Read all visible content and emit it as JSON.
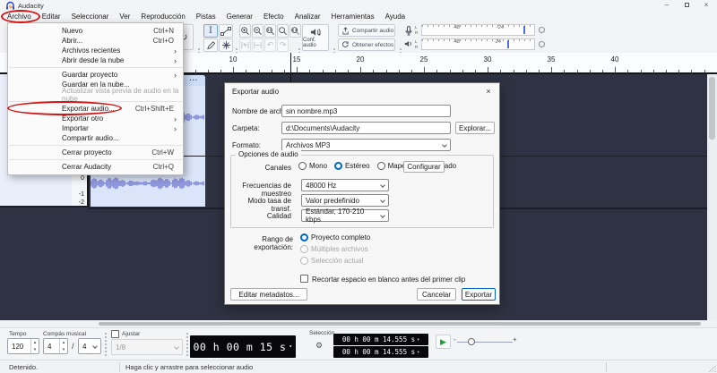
{
  "window": {
    "title": "Audacity"
  },
  "glyphs": {
    "minimize": "–",
    "close": "×",
    "submenu": "›",
    "dropdown": "▾",
    "undo": "↶",
    "redo": "↷",
    "loop": "↻",
    "gear": "⚙",
    "play": "▶",
    "minus": "-",
    "plus": "+",
    "ibeam": "I",
    "star": "✳",
    "ellipsis": "..."
  },
  "menubar": {
    "items": [
      "Archivo",
      "Editar",
      "Seleccionar",
      "Ver",
      "Reproducción",
      "Pistas",
      "Generar",
      "Efecto",
      "Analizar",
      "Herramientas",
      "Ayuda"
    ]
  },
  "file_menu": {
    "items": [
      {
        "label": "Nuevo",
        "shortcut": "Ctrl+N"
      },
      {
        "label": "Abrir...",
        "shortcut": "Ctrl+O"
      },
      {
        "label": "Archivos recientes",
        "submenu": true
      },
      {
        "label": "Abrir desde la nube",
        "submenu": true
      },
      {
        "separator": true
      },
      {
        "label": "Guardar proyecto",
        "submenu": true
      },
      {
        "label": "Guardar en la nube..."
      },
      {
        "label": "Actualizar vista previa de audio en la nube",
        "disabled": true
      },
      {
        "separator": true
      },
      {
        "label": "Exportar audio...",
        "shortcut": "Ctrl+Shift+E",
        "annotated": true
      },
      {
        "label": "Exportar otro",
        "submenu": true
      },
      {
        "label": "Importar",
        "submenu": true
      },
      {
        "label": "Compartir audio..."
      },
      {
        "separator": true
      },
      {
        "label": "Cerrar proyecto",
        "shortcut": "Ctrl+W"
      },
      {
        "separator": true
      },
      {
        "label": "Cerrar Audacity",
        "shortcut": "Ctrl+Q"
      }
    ]
  },
  "toolbar": {
    "conf_audio": "Conf. audio",
    "share_audio": "Compartir audio",
    "get_effects": "Obtener efectos",
    "meter_ticks": [
      "-48",
      "-24"
    ],
    "channel_labels": [
      "L",
      "R"
    ]
  },
  "ruler": {
    "labels": [
      "10",
      "15",
      "20",
      "25",
      "30",
      "35",
      "40"
    ]
  },
  "track": {
    "clip_title": "...",
    "scale_labels": [
      "0",
      "-1",
      "-2"
    ]
  },
  "dialog": {
    "title": "Exportar audio",
    "filename_label": "Nombre de archivo:",
    "filename_value": "sin nombre.mp3",
    "folder_label": "Carpeta:",
    "folder_value": "d:\\Documents\\Audacity",
    "browse_label": "Explorar...",
    "format_label": "Formato:",
    "format_value": "Archivos MP3",
    "audio_options_title": "Opciones de audio",
    "channels_label": "Canales",
    "channel_options": [
      {
        "label": "Mono",
        "selected": false
      },
      {
        "label": "Estéreo",
        "selected": true
      },
      {
        "label": "Mapeo personalizado",
        "selected": false
      }
    ],
    "configure_label": "Configurar",
    "sample_rate_label": "Frecuencias de muestreo",
    "sample_rate_value": "48000 Hz",
    "bitrate_mode_label": "Modo tasa de transf.",
    "bitrate_mode_value": "Valor predefinido",
    "quality_label": "Calidad",
    "quality_value": "Estándar, 170-210 kbps",
    "export_range_label": "Rango de exportación:",
    "export_range_options": [
      {
        "label": "Proyecto completo",
        "selected": true
      },
      {
        "label": "Múltiples archivos",
        "disabled": true
      },
      {
        "label": "Selección actual",
        "disabled": true
      }
    ],
    "trim_checkbox_label": "Recortar espacio en blanco antes del primer clip",
    "edit_metadata_label": "Editar metadatos...",
    "cancel_label": "Cancelar",
    "export_label": "Exportar"
  },
  "bottom": {
    "tempo_label": "Tempo",
    "tempo_value": "120",
    "time_sig_label": "Compás musical",
    "time_sig_upper": "4",
    "time_sig_slash": "/",
    "time_sig_lower": "4",
    "snap_label": "Ajustar",
    "snap_value": "1/8",
    "time_display": "00 h 00 m 15 s",
    "selection_label": "Selección",
    "selection_start": "00 h 00 m 14.555 s",
    "selection_end": "00 h 00 m 14.555 s"
  },
  "statusbar": {
    "state": "Detenido.",
    "hint": "Haga clic y arrastre para seleccionar audio"
  }
}
